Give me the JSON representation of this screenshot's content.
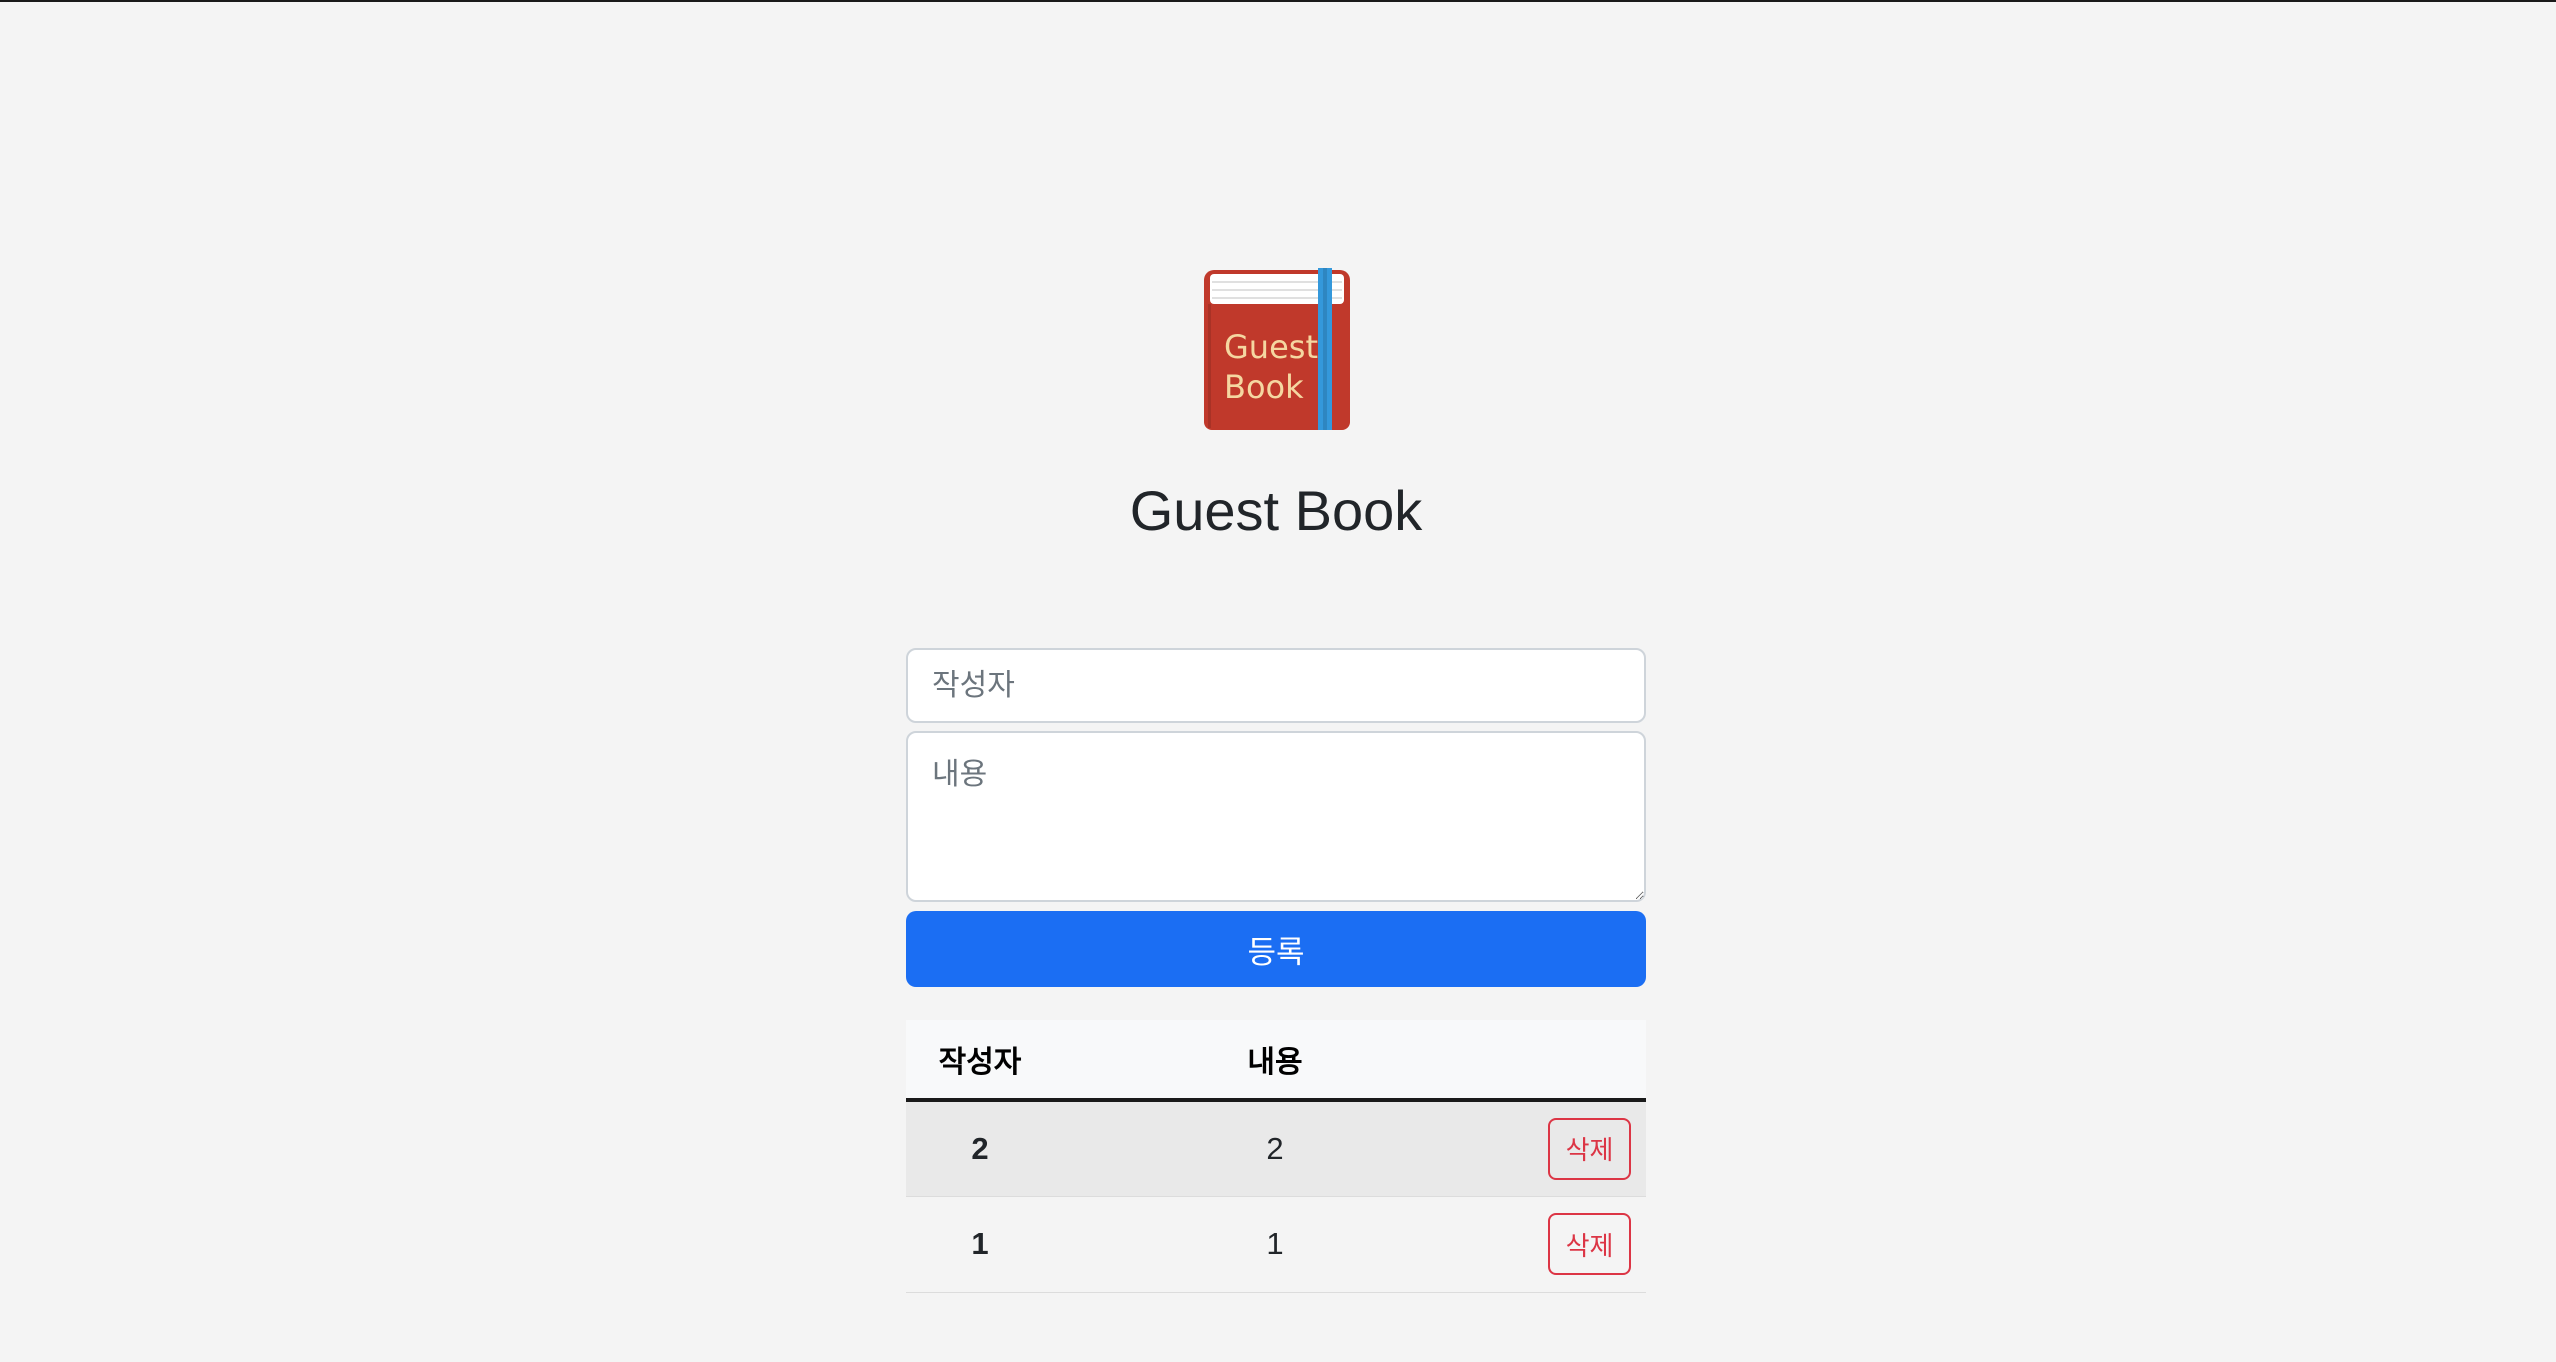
{
  "logo": {
    "line1": "Guest",
    "line2": "Book",
    "icon": "red-guestbook-icon",
    "cover_color": "#c0392b",
    "ribbon_color": "#3498db"
  },
  "header": {
    "title": "Guest Book"
  },
  "form": {
    "author_placeholder": "작성자",
    "author_value": "",
    "content_placeholder": "내용",
    "content_value": "",
    "submit_label": "등록",
    "submit_color": "#1b6ef3"
  },
  "table": {
    "headers": {
      "author": "작성자",
      "content": "내용",
      "action": ""
    },
    "rows": [
      {
        "author": "2",
        "content": "2",
        "delete_label": "삭제"
      },
      {
        "author": "1",
        "content": "1",
        "delete_label": "삭제"
      }
    ],
    "delete_color": "#dc3545"
  }
}
